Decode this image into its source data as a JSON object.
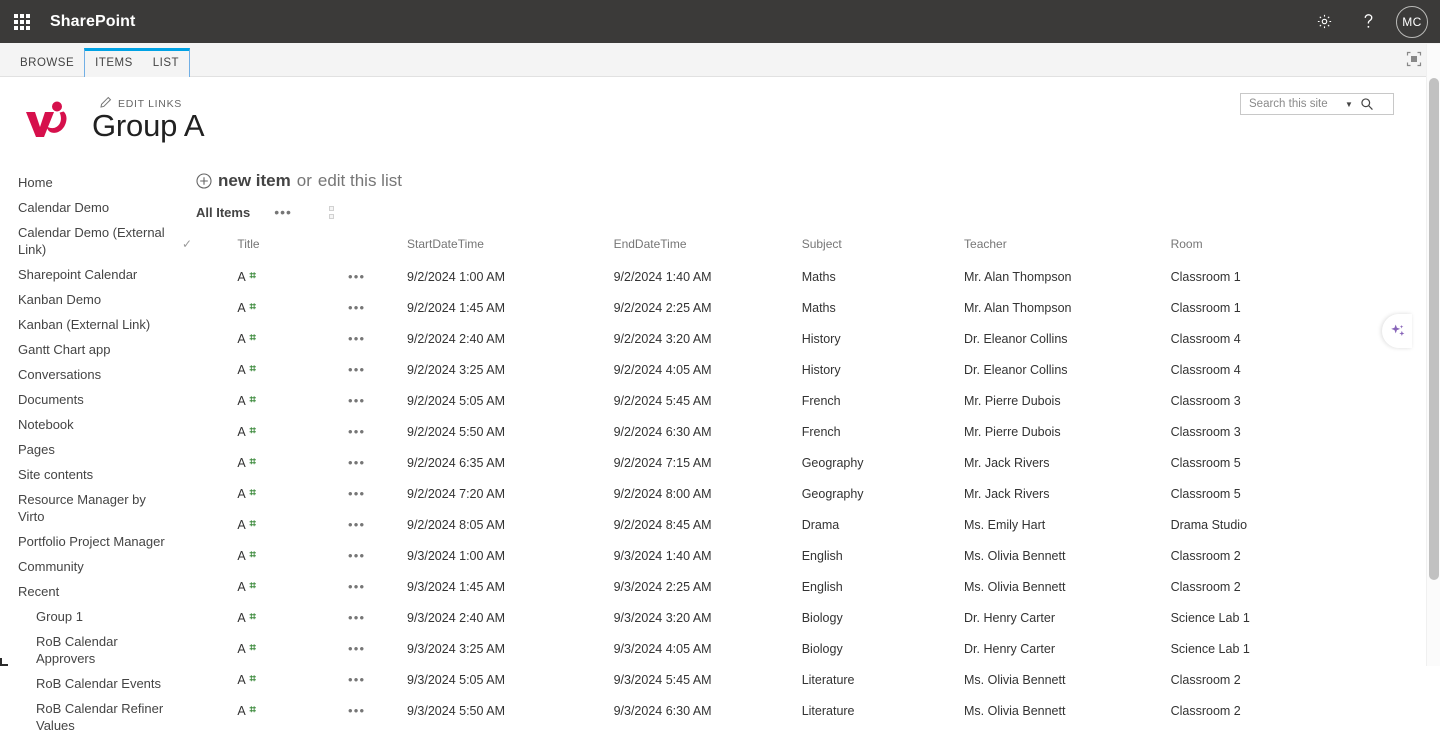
{
  "suite": {
    "brand": "SharePoint",
    "waffle_icon": "app-launcher-icon",
    "settings_icon": "gear-icon",
    "help_icon": "question-mark-icon",
    "avatar_initials": "MC"
  },
  "ribbon": {
    "tabs": [
      {
        "label": "BROWSE",
        "active": false
      },
      {
        "label": "ITEMS",
        "active": true
      },
      {
        "label": "LIST",
        "active": false
      }
    ],
    "focus_icon": "focus-on-content-icon",
    "accent_color": "#00a2e4"
  },
  "site": {
    "logo_icon": "virto-logo",
    "logo_color": "#d6104c",
    "edit_links_label": "EDIT LINKS",
    "edit_links_icon": "pencil-icon",
    "title": "Group A"
  },
  "search": {
    "placeholder": "Search this site",
    "value": "",
    "chevron_icon": "chevron-down-icon",
    "go_icon": "search-icon"
  },
  "left_nav": {
    "items": [
      {
        "label": "Home",
        "sub": false
      },
      {
        "label": "Calendar Demo",
        "sub": false
      },
      {
        "label": "Calendar Demo (External Link)",
        "sub": false
      },
      {
        "label": "Sharepoint Calendar",
        "sub": false
      },
      {
        "label": "Kanban Demo",
        "sub": false
      },
      {
        "label": "Kanban (External Link)",
        "sub": false
      },
      {
        "label": "Gantt Chart app",
        "sub": false
      },
      {
        "label": "Conversations",
        "sub": false
      },
      {
        "label": "Documents",
        "sub": false
      },
      {
        "label": "Notebook",
        "sub": false
      },
      {
        "label": "Pages",
        "sub": false
      },
      {
        "label": "Site contents",
        "sub": false
      },
      {
        "label": "Resource Manager by Virto",
        "sub": false
      },
      {
        "label": "Portfolio Project Manager",
        "sub": false
      },
      {
        "label": "Community",
        "sub": false
      },
      {
        "label": "Recent",
        "sub": false
      },
      {
        "label": "Group 1",
        "sub": true
      },
      {
        "label": "RoB Calendar Approvers",
        "sub": true
      },
      {
        "label": "RoB Calendar Events",
        "sub": true
      },
      {
        "label": "RoB Calendar Refiner Values",
        "sub": true
      }
    ]
  },
  "toolbar": {
    "new_item_icon": "plus-circle-icon",
    "new_item_label": "new item",
    "or_label": "or",
    "edit_list_label": "edit this list",
    "view_name": "All Items",
    "view_ellipsis": "•••",
    "view_broken_image_icon": "broken-image-icon"
  },
  "list": {
    "columns": [
      "Title",
      "StartDateTime",
      "EndDateTime",
      "Subject",
      "Teacher",
      "Room"
    ],
    "select_all_icon": "checkmark-icon",
    "row_menu_icon": "ellipsis-icon",
    "new_badge_icon": "new-item-badge-icon",
    "new_badge_color": "#3c8a3c",
    "rows": [
      {
        "title": "A",
        "new": true,
        "start": "9/2/2024 1:00 AM",
        "end": "9/2/2024 1:40 AM",
        "subject": "Maths",
        "teacher": "Mr. Alan Thompson",
        "room": "Classroom 1"
      },
      {
        "title": "A",
        "new": true,
        "start": "9/2/2024 1:45 AM",
        "end": "9/2/2024 2:25 AM",
        "subject": "Maths",
        "teacher": "Mr. Alan Thompson",
        "room": "Classroom 1"
      },
      {
        "title": "A",
        "new": true,
        "start": "9/2/2024 2:40 AM",
        "end": "9/2/2024 3:20 AM",
        "subject": "History",
        "teacher": "Dr. Eleanor Collins",
        "room": "Classroom 4"
      },
      {
        "title": "A",
        "new": true,
        "start": "9/2/2024 3:25 AM",
        "end": "9/2/2024 4:05 AM",
        "subject": "History",
        "teacher": "Dr. Eleanor Collins",
        "room": "Classroom 4"
      },
      {
        "title": "A",
        "new": true,
        "start": "9/2/2024 5:05 AM",
        "end": "9/2/2024 5:45 AM",
        "subject": "French",
        "teacher": "Mr. Pierre Dubois",
        "room": "Classroom 3"
      },
      {
        "title": "A",
        "new": true,
        "start": "9/2/2024 5:50 AM",
        "end": "9/2/2024 6:30 AM",
        "subject": "French",
        "teacher": "Mr. Pierre Dubois",
        "room": "Classroom 3"
      },
      {
        "title": "A",
        "new": true,
        "start": "9/2/2024 6:35 AM",
        "end": "9/2/2024 7:15 AM",
        "subject": "Geography",
        "teacher": "Mr. Jack Rivers",
        "room": "Classroom 5"
      },
      {
        "title": "A",
        "new": true,
        "start": "9/2/2024 7:20 AM",
        "end": "9/2/2024 8:00 AM",
        "subject": "Geography",
        "teacher": "Mr. Jack Rivers",
        "room": "Classroom 5"
      },
      {
        "title": "A",
        "new": true,
        "start": "9/2/2024 8:05 AM",
        "end": "9/2/2024 8:45 AM",
        "subject": "Drama",
        "teacher": "Ms. Emily Hart",
        "room": "Drama Studio"
      },
      {
        "title": "A",
        "new": true,
        "start": "9/3/2024 1:00 AM",
        "end": "9/3/2024 1:40 AM",
        "subject": "English",
        "teacher": "Ms. Olivia Bennett",
        "room": "Classroom 2"
      },
      {
        "title": "A",
        "new": true,
        "start": "9/3/2024 1:45 AM",
        "end": "9/3/2024 2:25 AM",
        "subject": "English",
        "teacher": "Ms. Olivia Bennett",
        "room": "Classroom 2"
      },
      {
        "title": "A",
        "new": true,
        "start": "9/3/2024 2:40 AM",
        "end": "9/3/2024 3:20 AM",
        "subject": "Biology",
        "teacher": "Dr. Henry Carter",
        "room": "Science Lab 1"
      },
      {
        "title": "A",
        "new": true,
        "start": "9/3/2024 3:25 AM",
        "end": "9/3/2024 4:05 AM",
        "subject": "Biology",
        "teacher": "Dr. Henry Carter",
        "room": "Science Lab 1"
      },
      {
        "title": "A",
        "new": true,
        "start": "9/3/2024 5:05 AM",
        "end": "9/3/2024 5:45 AM",
        "subject": "Literature",
        "teacher": "Ms. Olivia Bennett",
        "room": "Classroom 2"
      },
      {
        "title": "A",
        "new": true,
        "start": "9/3/2024 5:50 AM",
        "end": "9/3/2024 6:30 AM",
        "subject": "Literature",
        "teacher": "Ms. Olivia Bennett",
        "room": "Classroom 2"
      }
    ]
  },
  "copilot": {
    "icon": "copilot-sparkle-icon",
    "color": "#8764b8"
  }
}
